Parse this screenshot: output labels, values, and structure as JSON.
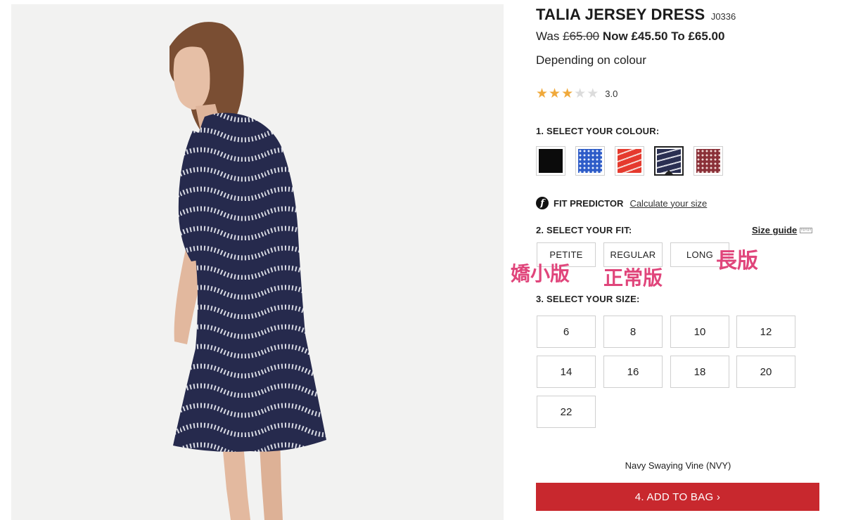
{
  "product": {
    "title": "TALIA JERSEY DRESS",
    "code": "J0336",
    "price": {
      "was_label": "Was",
      "was": "£65.00",
      "now_label": "Now",
      "now": "£45.50",
      "to_label": "To",
      "to": "£65.00"
    },
    "price_note": "Depending on colour",
    "rating": {
      "value": "3.0",
      "stars_filled": 3,
      "stars_total": 5
    }
  },
  "colour": {
    "label": "1. SELECT YOUR COLOUR:",
    "selected_name": "Navy Swaying Vine (NVY)",
    "swatches": [
      {
        "name": "black",
        "color": "#0b0b0b",
        "pattern": "plain"
      },
      {
        "name": "blue-print",
        "color": "#2e5cc8",
        "pattern": "dots"
      },
      {
        "name": "red-print",
        "color": "#e53a2e",
        "pattern": "waves"
      },
      {
        "name": "navy-swaying-vine",
        "color": "#2a2f52",
        "pattern": "waves",
        "selected": true
      },
      {
        "name": "burgundy-print",
        "color": "#8a3038",
        "pattern": "dots"
      }
    ]
  },
  "fit_predictor": {
    "label": "FIT PREDICTOR",
    "link": "Calculate your size",
    "icon": "f-logo-icon"
  },
  "fit": {
    "label": "2. SELECT YOUR FIT:",
    "size_guide": "Size guide",
    "options": [
      "PETITE",
      "REGULAR",
      "LONG"
    ],
    "annotations": [
      "嬌小版",
      "正常版",
      "長版"
    ]
  },
  "size": {
    "label": "3. SELECT YOUR SIZE:",
    "options": [
      "6",
      "8",
      "10",
      "12",
      "14",
      "16",
      "18",
      "20",
      "22"
    ]
  },
  "cart": {
    "add_label": "4. ADD TO BAG ›"
  },
  "colors": {
    "accent_red": "#c8282e",
    "star": "#f0a93b",
    "annotation_pink": "#e0457b"
  }
}
